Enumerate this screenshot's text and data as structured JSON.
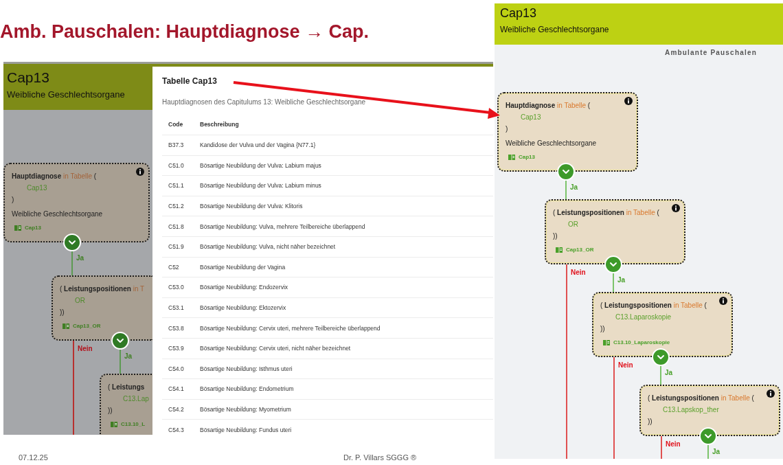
{
  "slide": {
    "title": "Amb. Pauschalen: Hauptdiagnose → Cap.",
    "date": "07.12.25",
    "author": "Dr. P. Villars SGGG ®"
  },
  "left_screenshot": {
    "dimmed": true,
    "header": {
      "title": "Cap13",
      "subtitle": "Weibliche Geschlechtsorgane"
    },
    "flow": [
      {
        "field": "Hauptdiagnose",
        "operator": "in Tabelle",
        "paren": "(",
        "value": "Cap13",
        "close": ")",
        "description": "Weibliche Geschlechtsorgane",
        "tag": "Cap13",
        "ja_label": "Ja"
      },
      {
        "open": "(",
        "field": "Leistungspositionen",
        "operator": "in T",
        "value": "OR",
        "close": "))",
        "tag": "Cap13_OR",
        "ja_label": "Ja",
        "nein_label": "Nein"
      },
      {
        "open": "(",
        "field": "Leistungs",
        "value": "C13.Lap",
        "close": "))",
        "tag": "C13.10_L"
      }
    ],
    "dialog": {
      "title": "Tabelle Cap13",
      "subtitle": "Hauptdiagnosen des Capitulums 13: Weibliche Geschlechtsorgane",
      "columns": [
        "Code",
        "Beschreibung"
      ],
      "rows": [
        {
          "code": "B37.3",
          "description": "Kandidose der Vulva und der Vagina {N77.1}"
        },
        {
          "code": "C51.0",
          "description": "Bösartige Neubildung der Vulva: Labium majus"
        },
        {
          "code": "C51.1",
          "description": "Bösartige Neubildung der Vulva: Labium minus"
        },
        {
          "code": "C51.2",
          "description": "Bösartige Neubildung der Vulva: Klitoris"
        },
        {
          "code": "C51.8",
          "description": "Bösartige Neubildung: Vulva, mehrere Teilbereiche überlappend"
        },
        {
          "code": "C51.9",
          "description": "Bösartige Neubildung: Vulva, nicht näher bezeichnet"
        },
        {
          "code": "C52",
          "description": "Bösartige Neubildung der Vagina"
        },
        {
          "code": "C53.0",
          "description": "Bösartige Neubildung: Endozervix"
        },
        {
          "code": "C53.1",
          "description": "Bösartige Neubildung: Ektozervix"
        },
        {
          "code": "C53.8",
          "description": "Bösartige Neubildung: Cervix uteri, mehrere Teilbereiche überlappend"
        },
        {
          "code": "C53.9",
          "description": "Bösartige Neubildung: Cervix uteri, nicht näher bezeichnet"
        },
        {
          "code": "C54.0",
          "description": "Bösartige Neubildung: Isthmus uteri"
        },
        {
          "code": "C54.1",
          "description": "Bösartige Neubildung: Endometrium"
        },
        {
          "code": "C54.2",
          "description": "Bösartige Neubildung: Myometrium"
        },
        {
          "code": "C54.3",
          "description": "Bösartige Neubildung: Fundus uteri"
        }
      ]
    }
  },
  "right_screenshot": {
    "dimmed": false,
    "header": {
      "title": "Cap13",
      "subtitle": "Weibliche Geschlechtsorgane"
    },
    "section_label": "Ambulante Pauschalen",
    "flow": [
      {
        "field": "Hauptdiagnose",
        "operator": "in Tabelle",
        "paren": "(",
        "value": "Cap13",
        "close": ")",
        "description": "Weibliche Geschlechtsorgane",
        "tag": "Cap13",
        "ja_label": "Ja"
      },
      {
        "open": "(",
        "field": "Leistungspositionen",
        "operator": "in Tabelle",
        "paren": "(",
        "value": "OR",
        "close": "))",
        "tag": "Cap13_OR",
        "ja_label": "Ja",
        "nein_label": "Nein"
      },
      {
        "open": "(",
        "field": "Leistungspositionen",
        "operator": "in Tabelle",
        "paren": "(",
        "value": "C13.Laparoskopie",
        "close": "))",
        "tag": "C13.10_Laparoskopie",
        "ja_label": "Ja",
        "nein_label": "Nein"
      },
      {
        "open": "(",
        "field": "Leistungspositionen",
        "operator": "in Tabelle",
        "paren": "(",
        "value": "C13.Lapskop_ther",
        "close": "))",
        "ja_label": "Ja",
        "nein_label": "Nein"
      }
    ]
  }
}
